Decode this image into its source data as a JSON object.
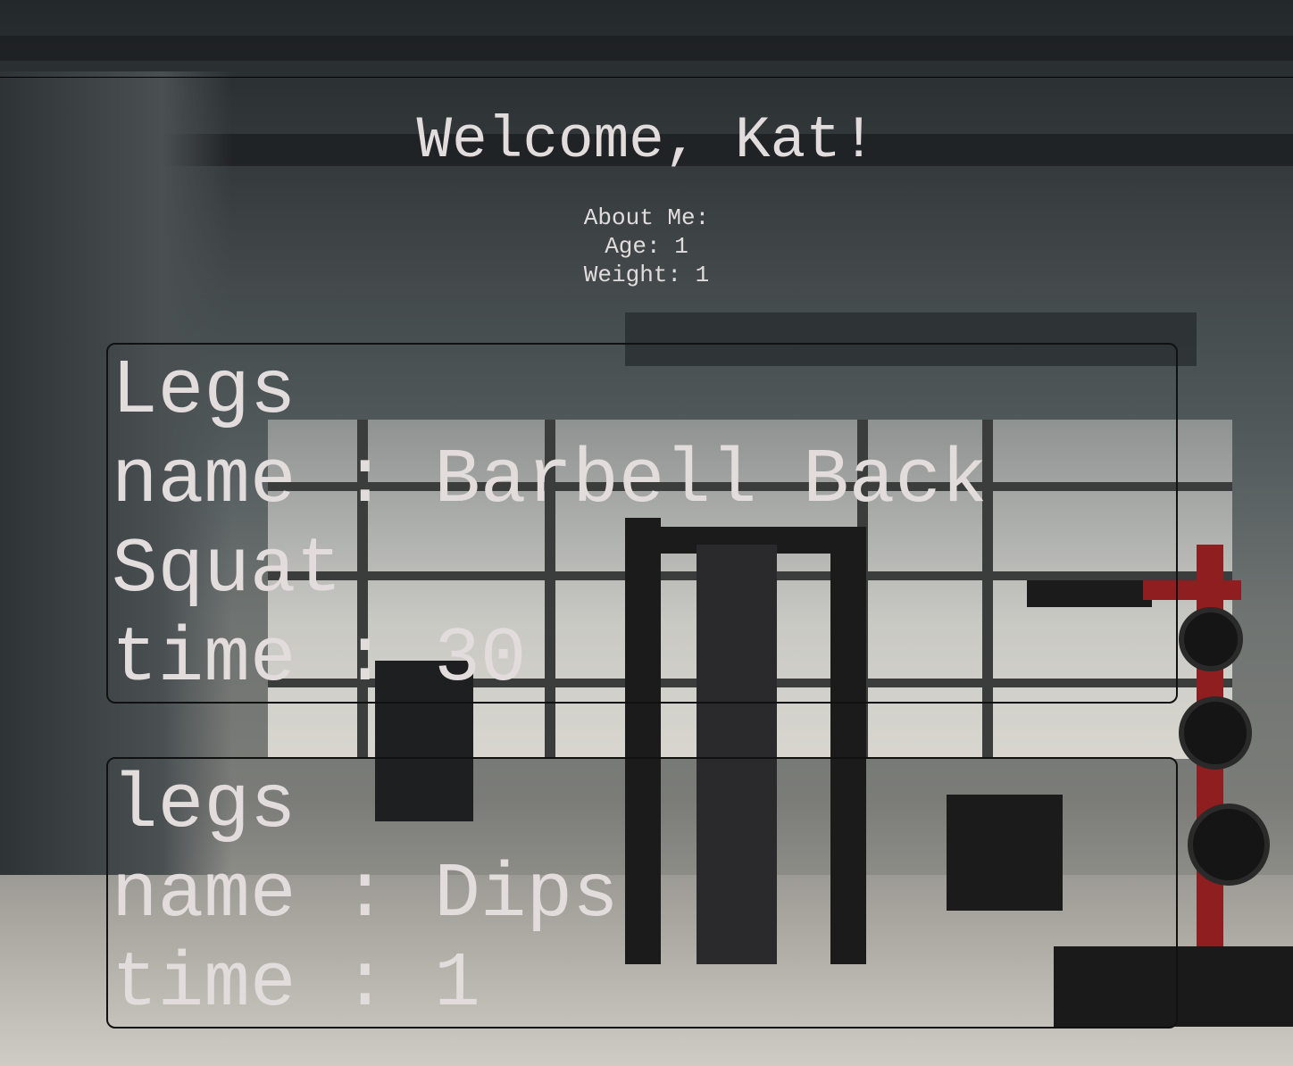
{
  "greeting": "Welcome, Kat!",
  "about": {
    "heading": "About Me:",
    "age_line": "Age: 1",
    "weight_line": "Weight: 1"
  },
  "workouts": [
    {
      "category": "Legs",
      "name_line": "name : Barbell Back Squat",
      "time_line": "time : 30"
    },
    {
      "category": "legs",
      "name_line": "name : Dips",
      "time_line": "time : 1"
    }
  ],
  "colors": {
    "text": "#e2dcdc",
    "card_border": "#111111"
  }
}
